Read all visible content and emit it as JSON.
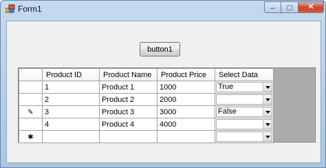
{
  "window": {
    "title": "Form1",
    "controls": {
      "minimize": "–",
      "maximize": "□",
      "close": "✕"
    }
  },
  "button1": {
    "label": "button1"
  },
  "grid": {
    "columns": [
      "Product ID",
      "Product Name",
      "Product Price",
      "Select Data"
    ],
    "rows": [
      {
        "indicator": "",
        "id": "1",
        "name": "Product 1",
        "price": "1000",
        "select": "True"
      },
      {
        "indicator": "",
        "id": "2",
        "name": "Product 2",
        "price": "2000",
        "select": ""
      },
      {
        "indicator": "✎",
        "id": "3",
        "name": "Product 3",
        "price": "3000",
        "select": "False"
      },
      {
        "indicator": "",
        "id": "4",
        "name": "Product 4",
        "price": "4000",
        "select": ""
      },
      {
        "indicator": "✱",
        "id": "",
        "name": "",
        "price": "",
        "select": ""
      }
    ]
  }
}
